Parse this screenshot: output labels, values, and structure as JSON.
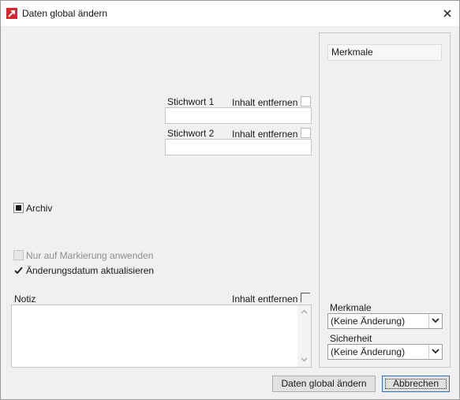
{
  "window": {
    "title": "Daten global ändern"
  },
  "stichwort1": {
    "label": "Stichwort 1",
    "remove_label": "Inhalt entfernen",
    "value": ""
  },
  "stichwort2": {
    "label": "Stichwort 2",
    "remove_label": "Inhalt entfernen",
    "value": ""
  },
  "archiv": {
    "label": "Archiv",
    "state": "indeterminate"
  },
  "options": {
    "markierung_label": "Nur auf Markierung anwenden",
    "aenderungsdatum_label": "Änderungsdatum aktualisieren"
  },
  "notiz": {
    "label": "Notiz",
    "remove_label": "Inhalt entfernen",
    "value": ""
  },
  "panel": {
    "header": "Merkmale",
    "merkmale_label": "Merkmale",
    "merkmale_value": "(Keine Änderung)",
    "sicherheit_label": "Sicherheit",
    "sicherheit_value": "(Keine Änderung)"
  },
  "buttons": {
    "apply": "Daten global ändern",
    "cancel": "Abbrechen"
  },
  "icons": {
    "app": "app-logo-icon",
    "close": "close-icon",
    "dropdown": "chevron-down-icon"
  },
  "colors": {
    "accent": "#d8262c"
  }
}
